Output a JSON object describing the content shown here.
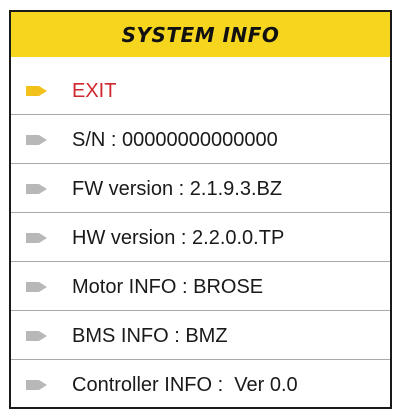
{
  "header": {
    "title": "SYSTEM INFO",
    "background_color": "#f6d51f"
  },
  "menu": {
    "selected_color": "#d0282e",
    "selected_arrow_color": "#f2c21b",
    "arrow_color": "#b8b8b8",
    "items": [
      {
        "label": "EXIT",
        "selected": true,
        "icon": "arrow-pointer-icon"
      },
      {
        "label": "S/N : 00000000000000",
        "selected": false,
        "icon": "arrow-pointer-icon"
      },
      {
        "label": "FW version : 2.1.9.3.BZ",
        "selected": false,
        "icon": "arrow-pointer-icon"
      },
      {
        "label": "HW version : 2.2.0.0.TP",
        "selected": false,
        "icon": "arrow-pointer-icon"
      },
      {
        "label": "Motor INFO : BROSE",
        "selected": false,
        "icon": "arrow-pointer-icon"
      },
      {
        "label": "BMS INFO : BMZ",
        "selected": false,
        "icon": "arrow-pointer-icon"
      },
      {
        "label": "Controller INFO :  Ver 0.0",
        "selected": false,
        "icon": "arrow-pointer-icon"
      }
    ]
  }
}
